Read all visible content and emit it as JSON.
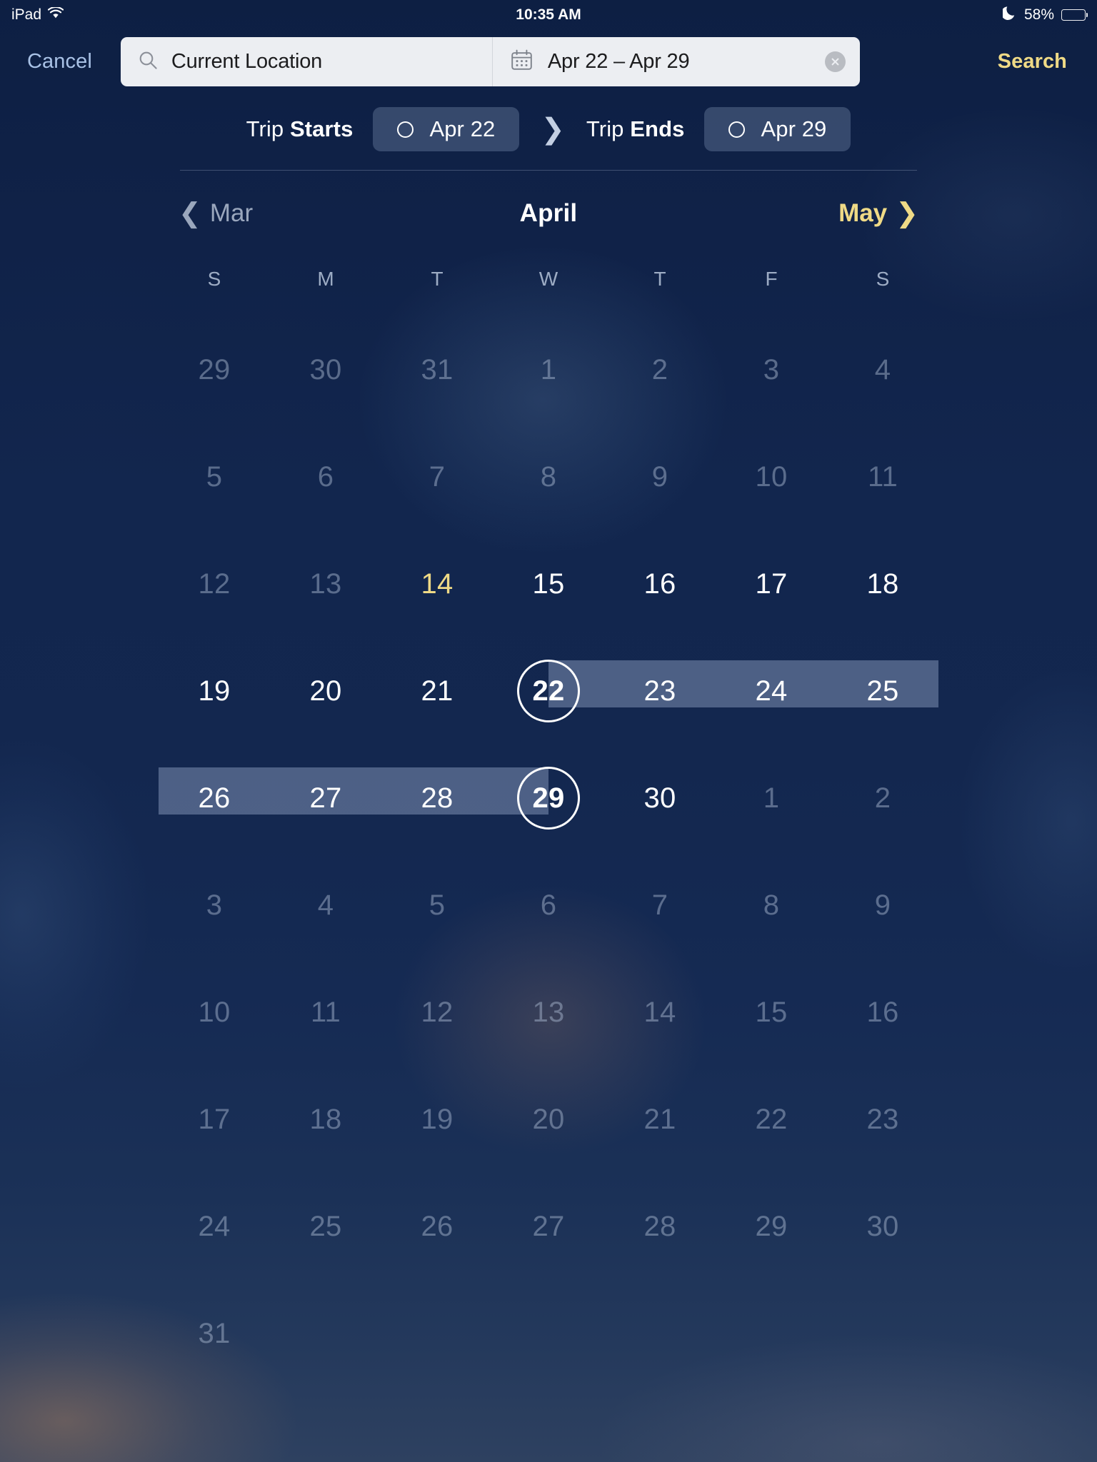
{
  "status_bar": {
    "device": "iPad",
    "wifi_icon": "wifi-icon",
    "time": "10:35 AM",
    "moon_icon": "moon-icon",
    "battery_percent": "58%",
    "battery_level": 58
  },
  "nav_bar": {
    "cancel_label": "Cancel",
    "search_label": "Search",
    "location_icon": "search-icon",
    "location_value": "Current Location",
    "location_placeholder": "Current Location",
    "calendar_icon": "calendar-icon",
    "date_value": "Apr 22 – Apr 29",
    "clear_icon": "clear-circle-icon"
  },
  "trip_row": {
    "start_label_light": "Trip ",
    "start_label_bold": "Starts",
    "start_pill_date": "Apr 22",
    "arrow_icon": "chevron-right-icon",
    "end_label_light": "Trip ",
    "end_label_bold": "Ends",
    "end_pill_date": "Apr 29",
    "pill_circle_icon": "circle-icon"
  },
  "month_nav": {
    "prev_chevron": "❮",
    "prev_month": "Mar",
    "current_month": "April",
    "next_month": "May",
    "next_chevron": "❯"
  },
  "calendar": {
    "weekdays": [
      "S",
      "M",
      "T",
      "W",
      "T",
      "F",
      "S"
    ],
    "colors": {
      "selected_band": "#879ABC",
      "today": "#EFDA86",
      "accent": "#EFDA86",
      "cancel": "#A9C2E6",
      "background": "#102348"
    },
    "selection": {
      "start": "Apr 22",
      "end": "Apr 29"
    },
    "weeks": [
      {
        "band": null,
        "days": [
          {
            "n": "29",
            "state": "dim"
          },
          {
            "n": "30",
            "state": "dim"
          },
          {
            "n": "31",
            "state": "dim"
          },
          {
            "n": "1",
            "state": "dim"
          },
          {
            "n": "2",
            "state": "dim"
          },
          {
            "n": "3",
            "state": "dim"
          },
          {
            "n": "4",
            "state": "dim"
          }
        ]
      },
      {
        "band": null,
        "days": [
          {
            "n": "5",
            "state": "dim"
          },
          {
            "n": "6",
            "state": "dim"
          },
          {
            "n": "7",
            "state": "dim"
          },
          {
            "n": "8",
            "state": "dim"
          },
          {
            "n": "9",
            "state": "dim"
          },
          {
            "n": "10",
            "state": "dim"
          },
          {
            "n": "11",
            "state": "dim"
          }
        ]
      },
      {
        "band": null,
        "days": [
          {
            "n": "12",
            "state": "dim"
          },
          {
            "n": "13",
            "state": "dim"
          },
          {
            "n": "14",
            "state": "today"
          },
          {
            "n": "15",
            "state": "normal"
          },
          {
            "n": "16",
            "state": "normal"
          },
          {
            "n": "17",
            "state": "normal"
          },
          {
            "n": "18",
            "state": "normal"
          }
        ]
      },
      {
        "band": {
          "from": 3,
          "to": 7
        },
        "days": [
          {
            "n": "19",
            "state": "normal"
          },
          {
            "n": "20",
            "state": "normal"
          },
          {
            "n": "21",
            "state": "normal"
          },
          {
            "n": "22",
            "state": "endpoint"
          },
          {
            "n": "23",
            "state": "normal"
          },
          {
            "n": "24",
            "state": "normal"
          },
          {
            "n": "25",
            "state": "normal"
          }
        ]
      },
      {
        "band": {
          "from": 0,
          "to": 4
        },
        "days": [
          {
            "n": "26",
            "state": "normal"
          },
          {
            "n": "27",
            "state": "normal"
          },
          {
            "n": "28",
            "state": "normal"
          },
          {
            "n": "29",
            "state": "endpoint"
          },
          {
            "n": "30",
            "state": "normal"
          },
          {
            "n": "1",
            "state": "dim"
          },
          {
            "n": "2",
            "state": "dim"
          }
        ]
      },
      {
        "band": null,
        "days": [
          {
            "n": "3",
            "state": "dim"
          },
          {
            "n": "4",
            "state": "dim"
          },
          {
            "n": "5",
            "state": "dim"
          },
          {
            "n": "6",
            "state": "dim"
          },
          {
            "n": "7",
            "state": "dim"
          },
          {
            "n": "8",
            "state": "dim"
          },
          {
            "n": "9",
            "state": "dim"
          }
        ]
      },
      {
        "band": null,
        "days": [
          {
            "n": "10",
            "state": "dim"
          },
          {
            "n": "11",
            "state": "dim"
          },
          {
            "n": "12",
            "state": "dim"
          },
          {
            "n": "13",
            "state": "dim"
          },
          {
            "n": "14",
            "state": "dim"
          },
          {
            "n": "15",
            "state": "dim"
          },
          {
            "n": "16",
            "state": "dim"
          }
        ]
      },
      {
        "band": null,
        "days": [
          {
            "n": "17",
            "state": "dim"
          },
          {
            "n": "18",
            "state": "dim"
          },
          {
            "n": "19",
            "state": "dim"
          },
          {
            "n": "20",
            "state": "dim"
          },
          {
            "n": "21",
            "state": "dim"
          },
          {
            "n": "22",
            "state": "dim"
          },
          {
            "n": "23",
            "state": "dim"
          }
        ]
      },
      {
        "band": null,
        "days": [
          {
            "n": "24",
            "state": "dim"
          },
          {
            "n": "25",
            "state": "dim"
          },
          {
            "n": "26",
            "state": "dim"
          },
          {
            "n": "27",
            "state": "dim"
          },
          {
            "n": "28",
            "state": "dim"
          },
          {
            "n": "29",
            "state": "dim"
          },
          {
            "n": "30",
            "state": "dim"
          }
        ]
      },
      {
        "band": null,
        "days": [
          {
            "n": "31",
            "state": "dim"
          },
          {
            "n": "",
            "state": "empty"
          },
          {
            "n": "",
            "state": "empty"
          },
          {
            "n": "",
            "state": "empty"
          },
          {
            "n": "",
            "state": "empty"
          },
          {
            "n": "",
            "state": "empty"
          },
          {
            "n": "",
            "state": "empty"
          }
        ]
      }
    ]
  }
}
